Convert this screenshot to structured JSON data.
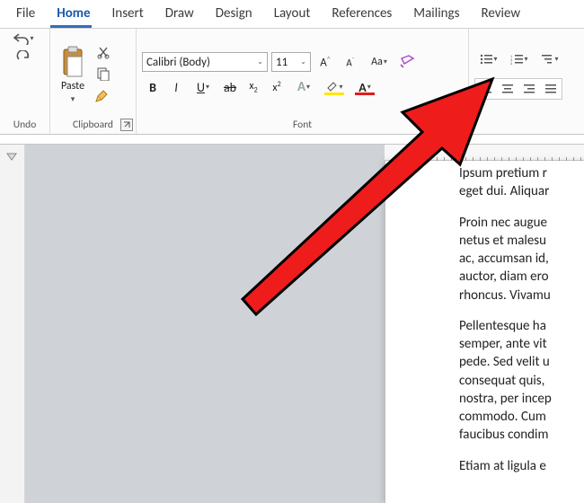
{
  "tabs": [
    "File",
    "Home",
    "Insert",
    "Draw",
    "Design",
    "Layout",
    "References",
    "Mailings",
    "Review"
  ],
  "active_tab": "Home",
  "groups": {
    "undo": "Undo",
    "clipboard": "Clipboard",
    "font": "Font",
    "paste_label": "Paste"
  },
  "font": {
    "name": "Calibri (Body)",
    "size": "11",
    "highlight_color": "#ffe600",
    "font_color": "#e11c1c"
  },
  "doc": {
    "p1a": "Ipsum pretium r",
    "p1b": "eget dui. Aliquar",
    "p2": "Proin nec augue\nnetus et malesu\nac, accumsan id,\nauctor, diam ero\nrhoncus. Vivamu",
    "p3": "Pellentesque ha\nsemper, ante vit\npede. Sed velit u\nconsequat quis,\nnostra, per incep\ncommodo. Cum\nfaucibus condim",
    "p4": "Etiam at ligula e"
  }
}
